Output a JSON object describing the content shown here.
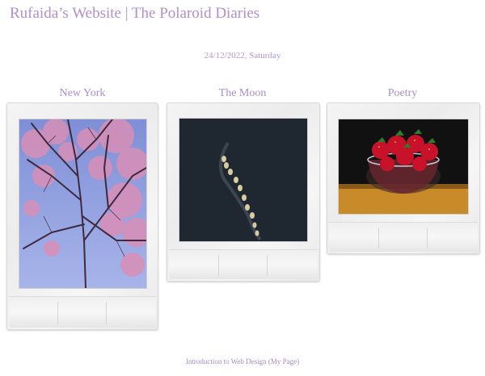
{
  "header": {
    "title": "Rufaida’s Website | The Polaroid Diaries",
    "date": "24/12/2022, Saturday"
  },
  "polaroids": [
    {
      "label": "New York",
      "photo": "cherry-blossom-tree-photo"
    },
    {
      "label": "The Moon",
      "photo": "moon-trail-photo"
    },
    {
      "label": "Poetry",
      "photo": "strawberries-bowl-painting"
    }
  ],
  "footer": {
    "link_label": "Introduction to Web Design (My Page)"
  },
  "colors": {
    "accent": "#b08fcc",
    "background": "#ffffff"
  }
}
